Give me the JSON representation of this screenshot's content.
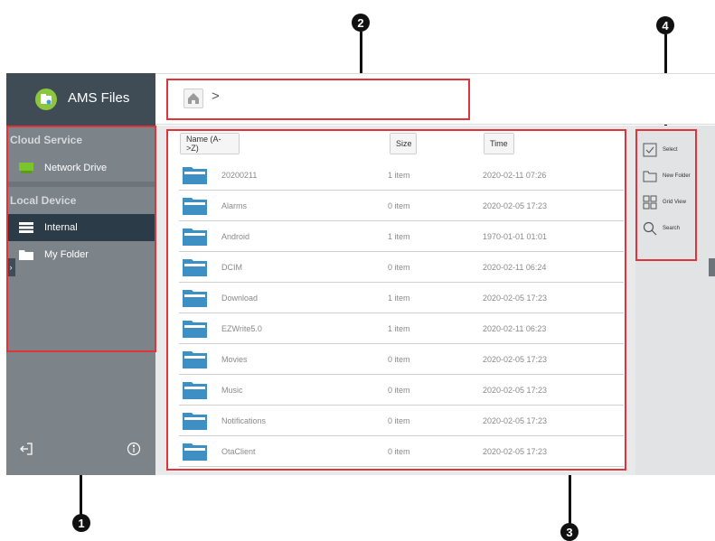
{
  "app": {
    "title": "AMS Files",
    "colors": {
      "sidebar_header": "#3f4c56",
      "sidebar": "#7c8389",
      "selected_item": "#2b3b47",
      "folder_blue": "#3d8fc4",
      "callout_box": "#e0343a"
    }
  },
  "callouts": [
    "1",
    "2",
    "3",
    "4"
  ],
  "sidebar": {
    "cloud_label": "Cloud Service",
    "cloud_items": [
      {
        "label": "Network Drive",
        "icon": "network-drive-icon"
      }
    ],
    "local_label": "Local Device",
    "local_items": [
      {
        "label": "Internal",
        "icon": "storage-icon",
        "selected": true
      },
      {
        "label": "My Folder",
        "icon": "folder-icon",
        "selected": false
      }
    ],
    "bottom_icons": [
      "logout-icon",
      "info-icon"
    ]
  },
  "breadcrumb": {
    "home_icon": "home-icon",
    "separator": ">"
  },
  "table": {
    "headers": {
      "name": "Name (A->Z)",
      "size": "Size",
      "time": "Time"
    },
    "rows": [
      {
        "name": "20200211",
        "size": "1 item",
        "time": "2020-02-11  07:26"
      },
      {
        "name": "Alarms",
        "size": "0 item",
        "time": "2020-02-05  17:23"
      },
      {
        "name": "Android",
        "size": "1 item",
        "time": "1970-01-01  01:01"
      },
      {
        "name": "DCIM",
        "size": "0 item",
        "time": "2020-02-11  06:24"
      },
      {
        "name": "Download",
        "size": "1 item",
        "time": "2020-02-05  17:23"
      },
      {
        "name": "EZWrite5.0",
        "size": "1 item",
        "time": "2020-02-11  06:23"
      },
      {
        "name": "Movies",
        "size": "0 item",
        "time": "2020-02-05  17:23"
      },
      {
        "name": "Music",
        "size": "0 item",
        "time": "2020-02-05  17:23"
      },
      {
        "name": "Notifications",
        "size": "0 item",
        "time": "2020-02-05  17:23"
      },
      {
        "name": "OtaClient",
        "size": "0 item",
        "time": "2020-02-05  17:23"
      },
      {
        "name": "",
        "size": "",
        "time": ""
      }
    ]
  },
  "actions": [
    {
      "label": "Select",
      "icon": "checkbox-icon"
    },
    {
      "label": "New Folder",
      "icon": "new-folder-icon"
    },
    {
      "label": "Grid View",
      "icon": "grid-icon"
    },
    {
      "label": "Search",
      "icon": "search-icon"
    }
  ]
}
